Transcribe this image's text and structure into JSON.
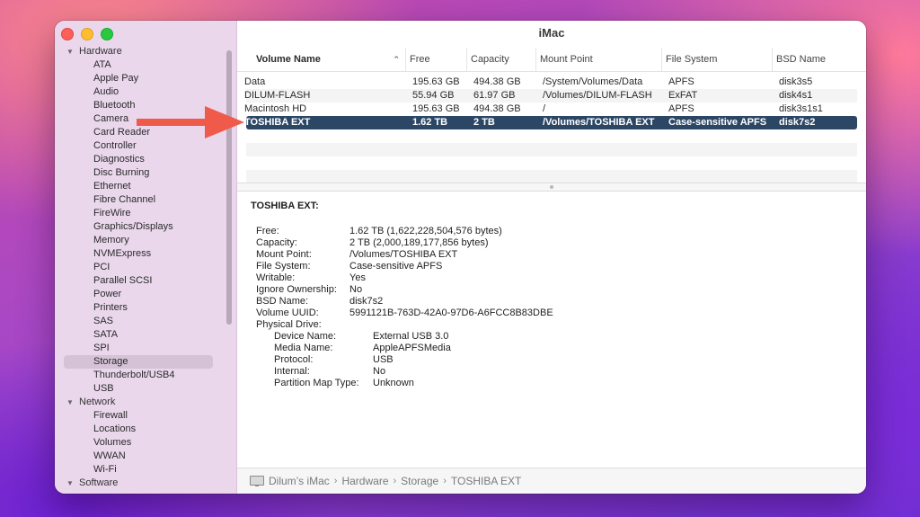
{
  "window": {
    "title": "iMac"
  },
  "sidebar": {
    "categories": [
      {
        "label": "Hardware",
        "expanded": true,
        "items": [
          "ATA",
          "Apple Pay",
          "Audio",
          "Bluetooth",
          "Camera",
          "Card Reader",
          "Controller",
          "Diagnostics",
          "Disc Burning",
          "Ethernet",
          "Fibre Channel",
          "FireWire",
          "Graphics/Displays",
          "Memory",
          "NVMExpress",
          "PCI",
          "Parallel SCSI",
          "Power",
          "Printers",
          "SAS",
          "SATA",
          "SPI",
          "Storage",
          "Thunderbolt/USB4",
          "USB"
        ]
      },
      {
        "label": "Network",
        "expanded": true,
        "items": [
          "Firewall",
          "Locations",
          "Volumes",
          "WWAN",
          "Wi-Fi"
        ]
      },
      {
        "label": "Software",
        "expanded": true,
        "items": []
      }
    ],
    "selected": "Storage"
  },
  "table": {
    "columns": [
      "Volume Name",
      "Free",
      "Capacity",
      "Mount Point",
      "File System",
      "BSD Name"
    ],
    "rows": [
      [
        "Data",
        "195.63 GB",
        "494.38 GB",
        "/System/Volumes/Data",
        "APFS",
        "disk3s5"
      ],
      [
        "DILUM-FLASH",
        "55.94 GB",
        "61.97 GB",
        "/Volumes/DILUM-FLASH",
        "ExFAT",
        "disk4s1"
      ],
      [
        "Macintosh HD",
        "195.63 GB",
        "494.38 GB",
        "/",
        "APFS",
        "disk3s1s1"
      ],
      [
        "TOSHIBA EXT",
        "1.62 TB",
        "2 TB",
        "/Volumes/TOSHIBA EXT",
        "Case-sensitive APFS",
        "disk7s2"
      ]
    ],
    "selected_row": 3
  },
  "detail": {
    "title": "TOSHIBA EXT:",
    "properties": [
      {
        "key": "Free:",
        "value": "1.62 TB (1,622,228,504,576 bytes)"
      },
      {
        "key": "Capacity:",
        "value": "2 TB (2,000,189,177,856 bytes)"
      },
      {
        "key": "Mount Point:",
        "value": "/Volumes/TOSHIBA EXT"
      },
      {
        "key": "File System:",
        "value": "Case-sensitive APFS"
      },
      {
        "key": "Writable:",
        "value": "Yes"
      },
      {
        "key": "Ignore Ownership:",
        "value": "No"
      },
      {
        "key": "BSD Name:",
        "value": "disk7s2"
      },
      {
        "key": "Volume UUID:",
        "value": "5991121B-763D-42A0-97D6-A6FCC8B83DBE"
      },
      {
        "key": "Physical Drive:",
        "value": ""
      }
    ],
    "physical_drive": [
      {
        "key": "Device Name:",
        "value": "External USB 3.0"
      },
      {
        "key": "Media Name:",
        "value": "AppleAPFSMedia"
      },
      {
        "key": "Protocol:",
        "value": "USB"
      },
      {
        "key": "Internal:",
        "value": "No"
      },
      {
        "key": "Partition Map Type:",
        "value": "Unknown"
      }
    ]
  },
  "statusbar": {
    "breadcrumbs": [
      "Dilum’s iMac",
      "Hardware",
      "Storage",
      "TOSHIBA EXT"
    ],
    "separator": "›"
  },
  "icons": {
    "computer": "imac-icon",
    "sort": "chevron-up-icon",
    "disclosure": "disclosure-down-icon",
    "annotation": "red-arrow-icon"
  },
  "colors": {
    "selection": "#2c4766",
    "sidebar": "#ead7ec",
    "arrow": "#ef5a4a"
  }
}
